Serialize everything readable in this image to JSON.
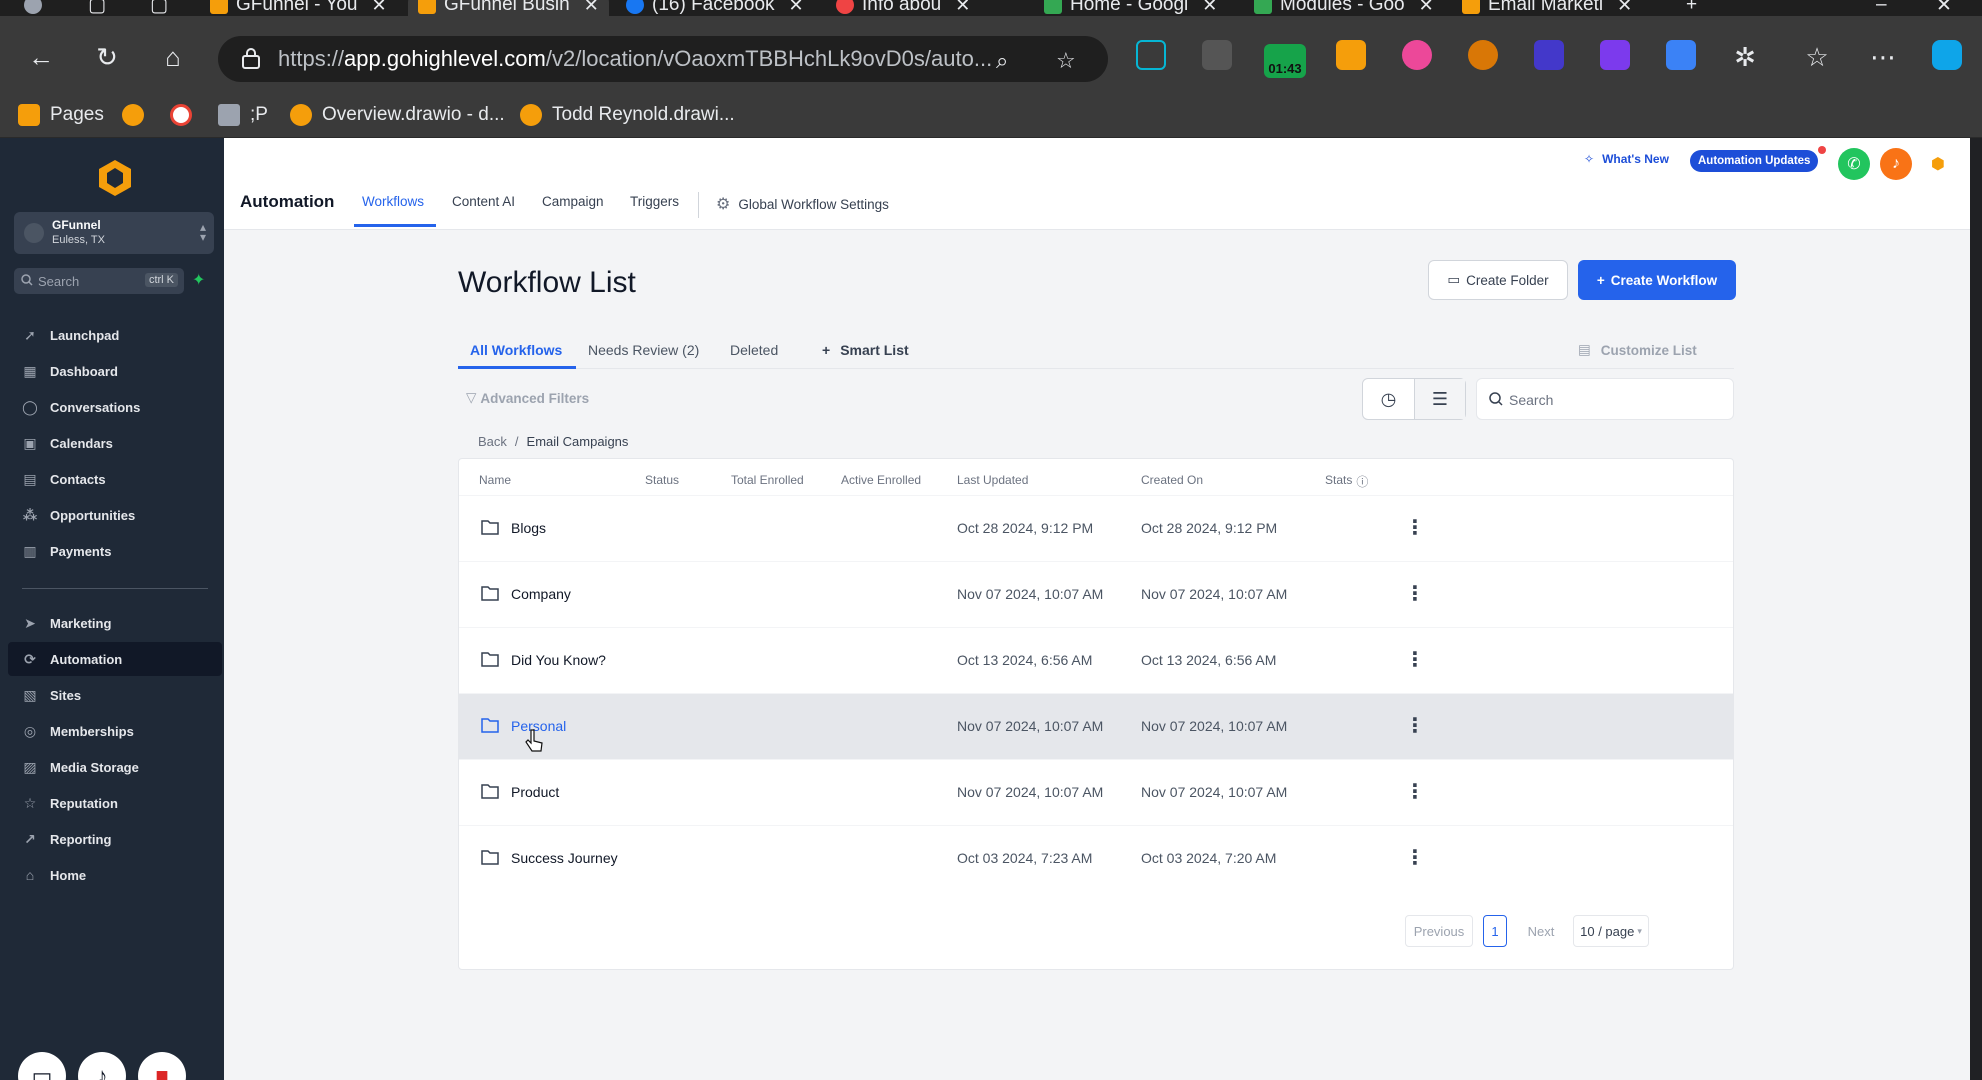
{
  "browser": {
    "tabs": [
      {
        "label": "GFunnel - You",
        "icon_color": "#f59e0b"
      },
      {
        "label": "GFunnel Busin",
        "icon_color": "#f59e0b",
        "active": true
      },
      {
        "label": "(16) Facebook",
        "icon_color": "#1877f2"
      },
      {
        "label": "Info abou",
        "icon_color": "#ef4444"
      },
      {
        "label": "Home - Googl",
        "icon_color": "#34a853"
      },
      {
        "label": "Modules - Goo",
        "icon_color": "#34a853"
      },
      {
        "label": "Email Marketi",
        "icon_color": "#f59e0b"
      }
    ],
    "url_prefix": "https://",
    "url_host": "app.gohighlevel.com",
    "url_rest": "/v2/location/vOaoxmTBBHchLk9ovD0s/auto...",
    "extension_timer": "01:43",
    "bookmarks": [
      {
        "label": "Pages"
      },
      {
        "label": ""
      },
      {
        "label": ""
      },
      {
        "label": ";P"
      },
      {
        "label": "Overview.drawio - d..."
      },
      {
        "label": "Todd Reynold.drawi..."
      }
    ]
  },
  "sidebar": {
    "account_name": "GFunnel",
    "account_location": "Euless, TX",
    "search_placeholder": "Search",
    "search_shortcut": "ctrl K",
    "items": [
      {
        "label": "Launchpad",
        "icon": "rocket-icon"
      },
      {
        "label": "Dashboard",
        "icon": "dashboard-icon"
      },
      {
        "label": "Conversations",
        "icon": "chat-icon"
      },
      {
        "label": "Calendars",
        "icon": "calendar-icon"
      },
      {
        "label": "Contacts",
        "icon": "contacts-icon"
      },
      {
        "label": "Opportunities",
        "icon": "opportunities-icon"
      },
      {
        "label": "Payments",
        "icon": "payments-icon"
      }
    ],
    "items2": [
      {
        "label": "Marketing",
        "icon": "send-icon"
      },
      {
        "label": "Automation",
        "icon": "automation-icon",
        "active": true
      },
      {
        "label": "Sites",
        "icon": "sites-icon"
      },
      {
        "label": "Memberships",
        "icon": "memberships-icon"
      },
      {
        "label": "Media Storage",
        "icon": "media-icon"
      },
      {
        "label": "Reputation",
        "icon": "star-icon"
      },
      {
        "label": "Reporting",
        "icon": "reporting-icon"
      },
      {
        "label": "Home",
        "icon": "home-icon"
      }
    ]
  },
  "header": {
    "section": "Automation",
    "tabs": [
      "Workflows",
      "Content AI",
      "Campaign",
      "Triggers"
    ],
    "settings_label": "Global Workflow Settings",
    "whats_new": "What's New",
    "updates_badge": "Automation Updates"
  },
  "page": {
    "title": "Workflow List",
    "create_folder": "Create Folder",
    "create_workflow": "Create Workflow",
    "subtabs": [
      "All Workflows",
      "Needs Review (2)",
      "Deleted"
    ],
    "smart_list": "Smart List",
    "customize": "Customize List",
    "advanced_filters": "Advanced Filters",
    "search_placeholder": "Search",
    "breadcrumb_back": "Back",
    "breadcrumb_current": "Email Campaigns"
  },
  "table": {
    "columns": [
      "Name",
      "Status",
      "Total Enrolled",
      "Active Enrolled",
      "Last Updated",
      "Created On",
      "Stats"
    ],
    "rows": [
      {
        "name": "Blogs",
        "last_updated": "Oct 28 2024, 9:12 PM",
        "created_on": "Oct 28 2024, 9:12 PM"
      },
      {
        "name": "Company",
        "last_updated": "Nov 07 2024, 10:07 AM",
        "created_on": "Nov 07 2024, 10:07 AM"
      },
      {
        "name": "Did You Know?",
        "last_updated": "Oct 13 2024, 6:56 AM",
        "created_on": "Oct 13 2024, 6:56 AM"
      },
      {
        "name": "Personal",
        "last_updated": "Nov 07 2024, 10:07 AM",
        "created_on": "Nov 07 2024, 10:07 AM"
      },
      {
        "name": "Product",
        "last_updated": "Nov 07 2024, 10:07 AM",
        "created_on": "Nov 07 2024, 10:07 AM"
      },
      {
        "name": "Success Journey",
        "last_updated": "Oct 03 2024, 7:23 AM",
        "created_on": "Oct 03 2024, 7:20 AM"
      }
    ]
  },
  "pagination": {
    "previous": "Previous",
    "current": "1",
    "next": "Next",
    "per_page": "10 / page"
  },
  "colors": {
    "accent": "#2563eb",
    "sidebar_bg": "#1f2937",
    "hover_row": "#e5e7eb"
  }
}
